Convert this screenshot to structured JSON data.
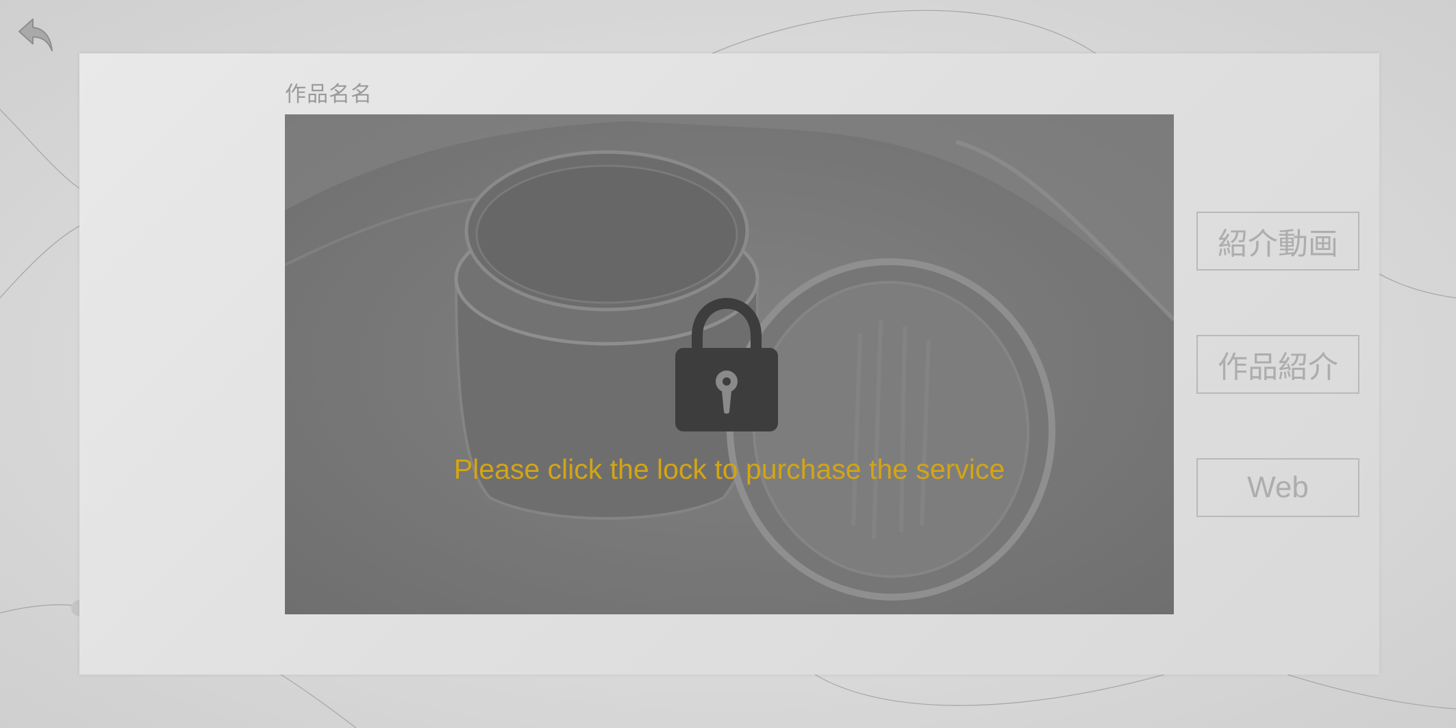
{
  "artwork": {
    "title": "作品名名",
    "lock_message": "Please click the lock to purchase the service"
  },
  "sidebar": {
    "buttons": [
      {
        "label": "紹介動画"
      },
      {
        "label": "作品紹介"
      },
      {
        "label": "Web"
      }
    ]
  },
  "icons": {
    "back": "back-arrow-icon",
    "lock": "padlock-icon"
  },
  "colors": {
    "accent": "#d4a514",
    "panel": "#e2e2e2",
    "button_text": "#adadad",
    "lock": "#3d3d3d"
  }
}
